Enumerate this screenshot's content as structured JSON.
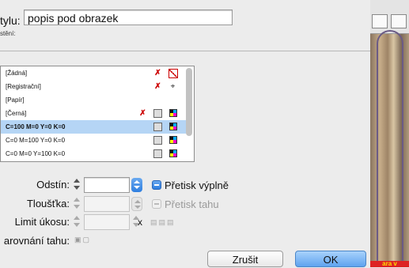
{
  "dialog": {
    "style_label": "tylu:",
    "style_name": "popis pod obrazek",
    "sub_label": "stění:"
  },
  "swatches": [
    {
      "name": "[Žádná]",
      "icon1": "no-edit-icon",
      "icon2": "none-swatch-icon"
    },
    {
      "name": "[Registrační]",
      "icon1": "no-edit-icon",
      "icon2": "registration-icon"
    },
    {
      "name": "[Papír]",
      "icon1": "",
      "icon2": ""
    },
    {
      "name": "[Černá]",
      "icon1": "no-edit-icon",
      "icon2": "process-icon",
      "icon3": "cmyk-icon"
    },
    {
      "name": "C=100 M=0 Y=0 K=0",
      "icon1": "process-icon",
      "icon2": "cmyk-icon",
      "selected": true
    },
    {
      "name": "C=0 M=100 Y=0 K=0",
      "icon1": "process-icon",
      "icon2": "cmyk-icon"
    },
    {
      "name": "C=0 M=0 Y=100 K=0",
      "icon1": "process-icon",
      "icon2": "cmyk-icon"
    }
  ],
  "fields": {
    "tint_label": "Odstín:",
    "tint_value": "",
    "overprint_fill_label": "Přetisk výplně",
    "weight_label": "Tloušťka:",
    "overprint_stroke_label": "Přetisk tahu",
    "miter_label": "Limit úkosu:",
    "miter_x": "x",
    "align_label": "arovnání tahu:"
  },
  "buttons": {
    "cancel": "Zrušit",
    "ok": "OK"
  },
  "background": {
    "red_text": "ara v"
  }
}
